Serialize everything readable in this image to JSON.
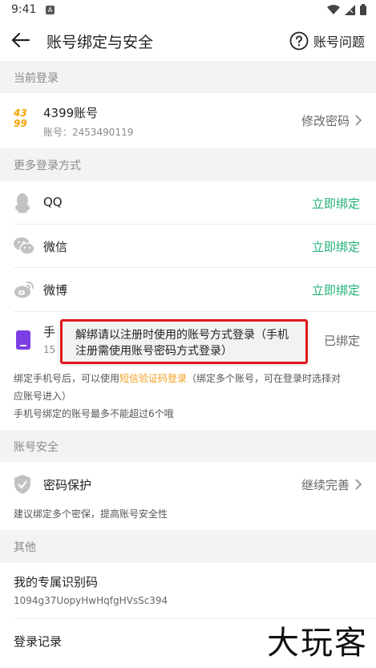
{
  "status_bar": {
    "time": "9:41",
    "notification_letter": "A"
  },
  "header": {
    "title": "账号绑定与安全",
    "help_label": "账号问题"
  },
  "sections": {
    "current_login": "当前登录",
    "more_login": "更多登录方式",
    "account_security": "账号安全",
    "other": "其他"
  },
  "account": {
    "logo_top": "43",
    "logo_bottom": "99",
    "name": "4399账号",
    "id_line": "账号：2453490119",
    "change_password": "修改密码"
  },
  "bindings": [
    {
      "name": "QQ",
      "icon": "qq-icon",
      "action": "立即绑定"
    },
    {
      "name": "微信",
      "icon": "wechat-icon",
      "action": "立即绑定"
    },
    {
      "name": "微博",
      "icon": "weibo-icon",
      "action": "立即绑定"
    }
  ],
  "phone": {
    "label_partial": "手",
    "number_partial": "15",
    "status": "已绑定"
  },
  "phone_note": {
    "line1_prefix": "绑定手机号后，可以使用",
    "line1_link": "短信验证码登录",
    "line1_suffix": "（绑定多个账号，可在登录时选择对",
    "line2": "应账号进入）",
    "line3": "手机号绑定的账号最多不能超过6个哦"
  },
  "security": {
    "label": "密码保护",
    "action": "继续完善",
    "note": "建议绑定多个密保，提高账号安全性"
  },
  "other": {
    "id_label": "我的专属识别码",
    "id_value": "1094g37UopyHwHqfgHVsSc394",
    "login_record": "登录记录"
  },
  "toast": {
    "line1": "解绑请以注册时使用的账号方式登录（手机",
    "line2": "注册需使用账号密码方式登录）"
  },
  "watermark": "大玩客",
  "colors": {
    "accent_green": "#20b075",
    "link_orange": "#f0a020",
    "highlight_red": "#e0191b",
    "phone_purple": "#7b3fe4",
    "logo_orange": "#f5a300"
  }
}
